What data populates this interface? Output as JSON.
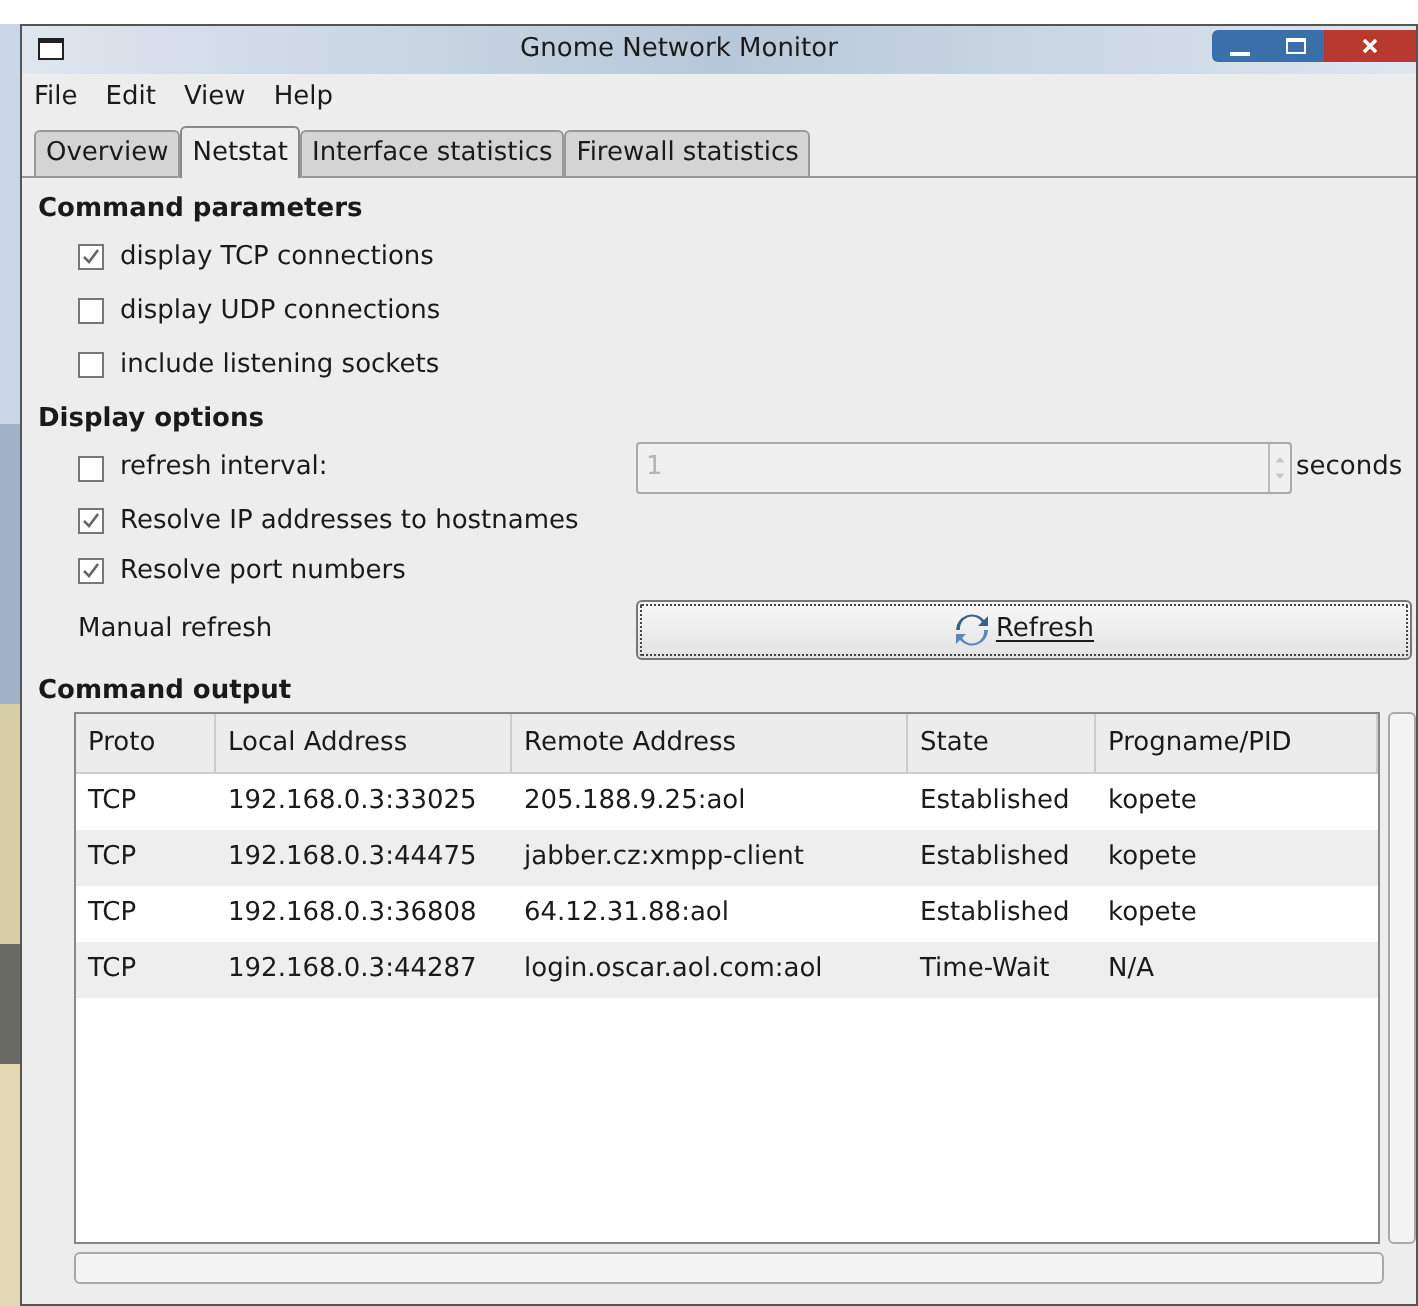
{
  "window": {
    "title": "Gnome Network Monitor"
  },
  "menu": [
    "File",
    "Edit",
    "View",
    "Help"
  ],
  "tabs": [
    {
      "label": "Overview",
      "selected": false
    },
    {
      "label": "Netstat",
      "selected": true
    },
    {
      "label": "Interface statistics",
      "selected": false
    },
    {
      "label": "Firewall statistics",
      "selected": false
    }
  ],
  "command_parameters": {
    "heading": "Command parameters",
    "options": [
      {
        "label": "display TCP connections",
        "checked": true
      },
      {
        "label": "display UDP connections",
        "checked": false
      },
      {
        "label": "include listening sockets",
        "checked": false
      }
    ]
  },
  "display_options": {
    "heading": "Display options",
    "refresh_interval": {
      "label": "refresh interval:",
      "checked": false,
      "value": "1",
      "unit": "seconds",
      "disabled": true
    },
    "options": [
      {
        "label": "Resolve IP addresses to hostnames",
        "checked": true
      },
      {
        "label": "Resolve port numbers",
        "checked": true
      }
    ],
    "manual_refresh": {
      "label": "Manual refresh",
      "button": "Refresh"
    }
  },
  "command_output": {
    "heading": "Command output",
    "columns": [
      "Proto",
      "Local Address",
      "Remote Address",
      "State",
      "Progname/PID"
    ],
    "rows": [
      [
        "TCP",
        "192.168.0.3:33025",
        "205.188.9.25:aol",
        "Established",
        "kopete"
      ],
      [
        "TCP",
        "192.168.0.3:44475",
        "jabber.cz:xmpp-client",
        "Established",
        "kopete"
      ],
      [
        "TCP",
        "192.168.0.3:36808",
        "64.12.31.88:aol",
        "Established",
        "kopete"
      ],
      [
        "TCP",
        "192.168.0.3:44287",
        "login.oscar.aol.com:aol",
        "Time-Wait",
        "N/A"
      ]
    ]
  }
}
